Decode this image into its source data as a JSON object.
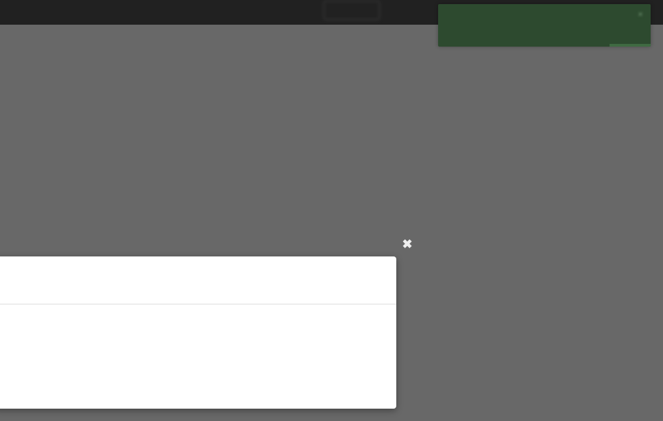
{
  "nav": {
    "user_text": "",
    "button_label": ""
  },
  "toast": {
    "message": "",
    "close_glyph": "×",
    "color": "#2d4a2f"
  },
  "modal": {
    "close_glyph": "✖",
    "header_title": "",
    "body_text": ""
  },
  "colors": {
    "overlay": "rgba(40,40,40,0.7)",
    "nav_bg": "#111111",
    "modal_bg": "#ffffff"
  },
  "icons": {
    "toast_close": "close-icon",
    "modal_close": "close-icon"
  }
}
